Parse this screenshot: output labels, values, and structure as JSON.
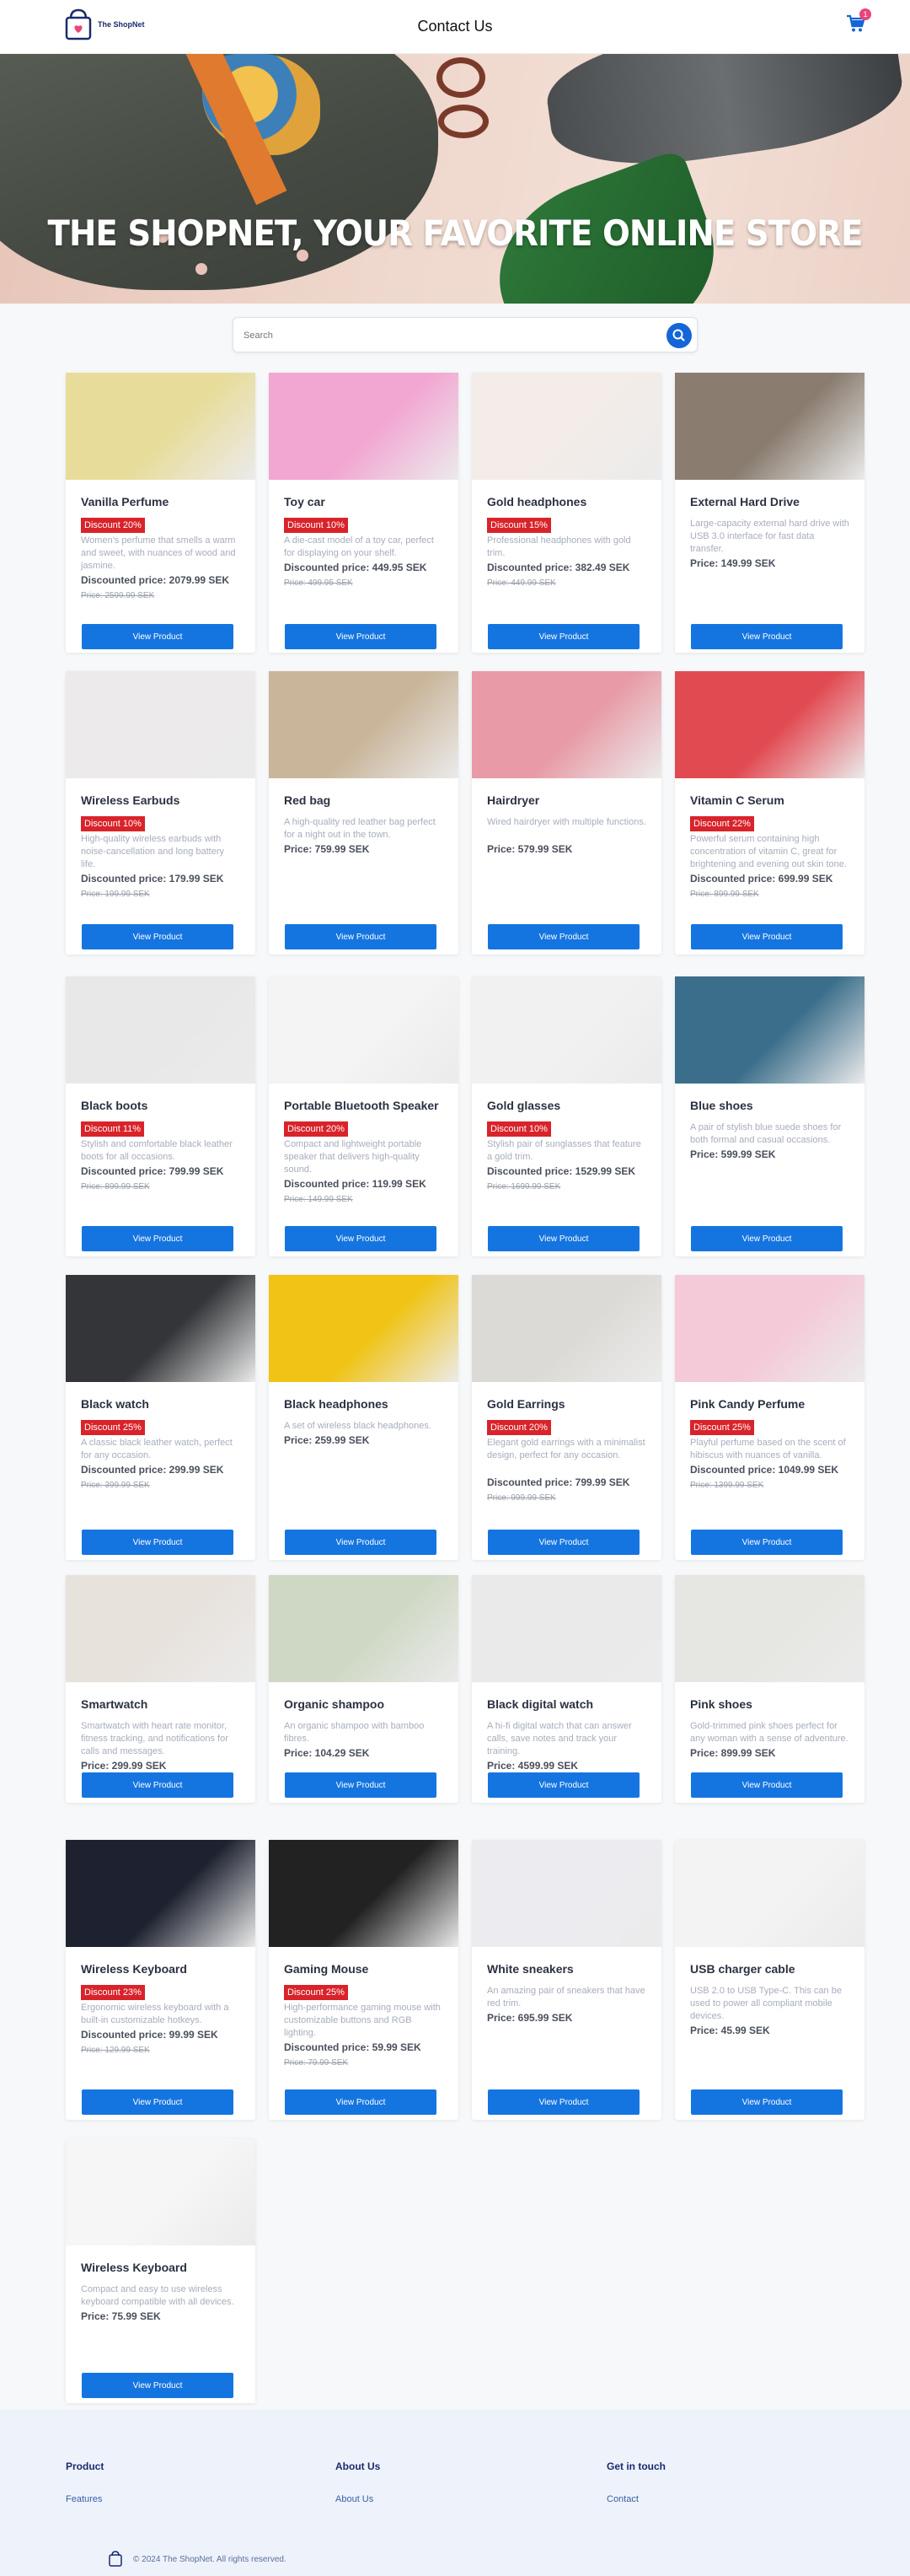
{
  "header": {
    "logo_text": "The ShopNet",
    "title": "Contact Us",
    "cart_count": "1"
  },
  "hero": {
    "title": "THE SHOPNET, YOUR FAVORITE ONLINE STORE"
  },
  "search": {
    "placeholder": "Search"
  },
  "button_label": "View Product",
  "products": [
    {
      "name": "Vanilla Perfume",
      "discount": "Discount 20%",
      "desc": "Women's perfume that smells a warm and sweet, with nuances of wood and jasmine.",
      "price": "Discounted price: 2079.99 SEK",
      "old": "Price: 2599.99 SEK",
      "color": "#e8dc9a"
    },
    {
      "name": "Toy car",
      "discount": "Discount 10%",
      "desc": "A die-cast model of a toy car, perfect for displaying on your shelf.",
      "price": "Discounted price: 449.95 SEK",
      "old": "Price: 499.95 SEK",
      "color": "#f2a6d2"
    },
    {
      "name": "Gold headphones",
      "discount": "Discount 15%",
      "desc": "Professional headphones with gold trim.",
      "price": "Discounted price: 382.49 SEK",
      "old": "Price: 449.99 SEK",
      "color": "#f3ece8"
    },
    {
      "name": "External Hard Drive",
      "discount": "",
      "desc": "Large-capacity external hard drive with USB 3.0 interface for fast data transfer.",
      "price": "Price: 149.99 SEK",
      "old": "",
      "color": "#8a7d70"
    },
    {
      "name": "Wireless Earbuds",
      "discount": "Discount 10%",
      "desc": "High-quality wireless earbuds with noise-cancellation and long battery life.",
      "price": "Discounted price: 179.99 SEK",
      "old": "Price: 199.99 SEK",
      "color": "#eceaea"
    },
    {
      "name": "Red bag",
      "discount": "",
      "desc": "A high-quality red leather bag perfect for a night out in the town.",
      "price": "Price: 759.99 SEK",
      "old": "",
      "color": "#c9b59a"
    },
    {
      "name": "Hairdryer",
      "discount": "",
      "desc": "Wired hairdryer with multiple functions.",
      "price": "Price: 579.99 SEK",
      "old": "",
      "color": "#e89aa6"
    },
    {
      "name": "Vitamin C Serum",
      "discount": "Discount 22%",
      "desc": "Powerful serum containing high concentration of vitamin C, great for brightening and evening out skin tone.",
      "price": "Discounted price: 699.99 SEK",
      "old": "Price: 899.99 SEK",
      "color": "#e24a52"
    },
    {
      "name": "Black boots",
      "discount": "Discount 11%",
      "desc": "Stylish and comfortable black leather boots for all occasions.",
      "price": "Discounted price: 799.99 SEK",
      "old": "Price: 899.99 SEK",
      "color": "#e8e8e8"
    },
    {
      "name": "Portable Bluetooth Speaker",
      "discount": "Discount 20%",
      "desc": "Compact and lightweight portable speaker that delivers high-quality sound.",
      "price": "Discounted price: 119.99 SEK",
      "old": "Price: 149.99 SEK",
      "color": "#f4f4f4"
    },
    {
      "name": "Gold glasses",
      "discount": "Discount 10%",
      "desc": "Stylish pair of sunglasses that feature a gold trim.",
      "price": "Discounted price: 1529.99 SEK",
      "old": "Price: 1699.99 SEK",
      "color": "#f1f1f1"
    },
    {
      "name": "Blue shoes",
      "discount": "",
      "desc": "A pair of stylish blue suede shoes for both formal and casual occasions.",
      "price": "Price: 599.99 SEK",
      "old": "",
      "color": "#3a6e8a"
    },
    {
      "name": "Black watch",
      "discount": "Discount 25%",
      "desc": "A classic black leather watch, perfect for any occasion.",
      "price": "Discounted price: 299.99 SEK",
      "old": "Price: 399.99 SEK",
      "color": "#333538"
    },
    {
      "name": "Black headphones",
      "discount": "",
      "desc": "A set of wireless black headphones.",
      "price": "Price: 259.99 SEK",
      "old": "",
      "color": "#f0c314"
    },
    {
      "name": "Gold Earrings",
      "discount": "Discount 20%",
      "desc": "Elegant gold earrings with a minimalist design, perfect for any occasion.",
      "price": "Discounted price: 799.99 SEK",
      "old": "Price: 999.99 SEK",
      "color": "#dcdad6"
    },
    {
      "name": "Pink Candy Perfume",
      "discount": "Discount 25%",
      "desc": "Playful perfume based on the scent of hibiscus with nuances of vanilla.",
      "price": "Discounted price: 1049.99 SEK",
      "old": "Price: 1399.99 SEK",
      "color": "#f4c9d8"
    },
    {
      "name": "Smartwatch",
      "discount": "",
      "desc": "Smartwatch with heart rate monitor, fitness tracking, and notifications for calls and messages.",
      "price": "Price: 299.99 SEK",
      "old": "",
      "color": "#e8e2dc"
    },
    {
      "name": "Organic shampoo",
      "discount": "",
      "desc": "An organic shampoo with bamboo fibres.",
      "price": "Price: 104.29 SEK",
      "old": "",
      "color": "#cfd8c4"
    },
    {
      "name": "Black digital watch",
      "discount": "",
      "desc": "A hi-fi digital watch that can answer calls, save notes and track your training.",
      "price": "Price: 4599.99 SEK",
      "old": "",
      "color": "#eaeaea"
    },
    {
      "name": "Pink shoes",
      "discount": "",
      "desc": "Gold-trimmed pink shoes perfect for any woman with a sense of adventure.",
      "price": "Price: 899.99 SEK",
      "old": "",
      "color": "#e6e6e2"
    },
    {
      "name": "Wireless Keyboard",
      "discount": "Discount 23%",
      "desc": "Ergonomic wireless keyboard with a built-in customizable hotkeys.",
      "price": "Discounted price: 99.99 SEK",
      "old": "Price: 129.99 SEK",
      "color": "#1e2230"
    },
    {
      "name": "Gaming Mouse",
      "discount": "Discount 25%",
      "desc": "High-performance gaming mouse with customizable buttons and RGB lighting.",
      "price": "Discounted price: 59.99 SEK",
      "old": "Price: 79.99 SEK",
      "color": "#222222"
    },
    {
      "name": "White sneakers",
      "discount": "",
      "desc": "An amazing pair of sneakers that have red trim.",
      "price": "Price: 695.99 SEK",
      "old": "",
      "color": "#ecebf0"
    },
    {
      "name": "USB charger cable",
      "discount": "",
      "desc": "USB 2.0 to USB Type-C. This can be used to power all compliant mobile devices.",
      "price": "Price: 45.99 SEK",
      "old": "",
      "color": "#f3f3f3"
    },
    {
      "name": "Wireless Keyboard",
      "discount": "",
      "desc": "Compact and easy to use wireless keyboard compatible with all devices.",
      "price": "Price: 75.99 SEK",
      "old": "",
      "color": "#f6f6f6"
    }
  ],
  "footer": {
    "col1_title": "Product",
    "col1_link": "Features",
    "col2_title": "About Us",
    "col2_link": "About Us",
    "col3_title": "Get in touch",
    "col3_link": "Contact",
    "copyright": "© 2024 The ShopNet. All rights reserved."
  }
}
